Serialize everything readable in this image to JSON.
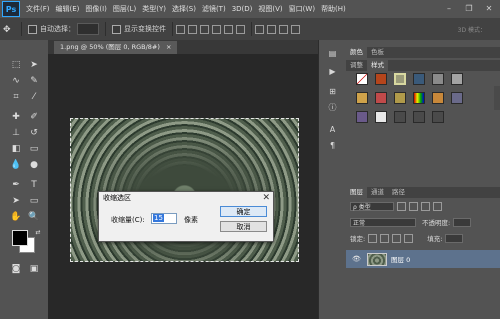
{
  "app": {
    "logo": "Ps",
    "menu": [
      "文件(F)",
      "编辑(E)",
      "图像(I)",
      "图层(L)",
      "类型(Y)",
      "选择(S)",
      "滤镜(T)",
      "3D(D)",
      "视图(V)",
      "窗口(W)",
      "帮助(H)"
    ],
    "window_controls": [
      "minimize-icon",
      "restore-icon",
      "close-icon"
    ]
  },
  "options_bar": {
    "auto_select_label": "自动选择：",
    "transform_label": "显示变换控件",
    "mode_3d": "3D 模式："
  },
  "document": {
    "tab_label": "1.png @ 50% (图层 0, RGB/8#)",
    "tab_close": "×"
  },
  "dialog": {
    "title": "收缩选区",
    "close": "✕",
    "field_label": "收缩量(C):",
    "field_value": "15",
    "unit": "像素",
    "ok_label": "确定",
    "cancel_label": "取消"
  },
  "panels": {
    "color_tabs": [
      "颜色",
      "色板"
    ],
    "adjust_tabs": [
      "调整",
      "样式"
    ],
    "layers_tabs": [
      "图层",
      "通道",
      "路径"
    ],
    "filter_kind": "ρ 类型",
    "blend_mode": "正常",
    "opacity_label": "不透明度:",
    "lock_label": "锁定:",
    "fill_label": "填充:",
    "layer_name": "图层 0"
  },
  "colors": {
    "accent": "#31a8ff",
    "selected_layer": "#5d728d",
    "foreground": "#000000",
    "background": "#ffffff"
  }
}
